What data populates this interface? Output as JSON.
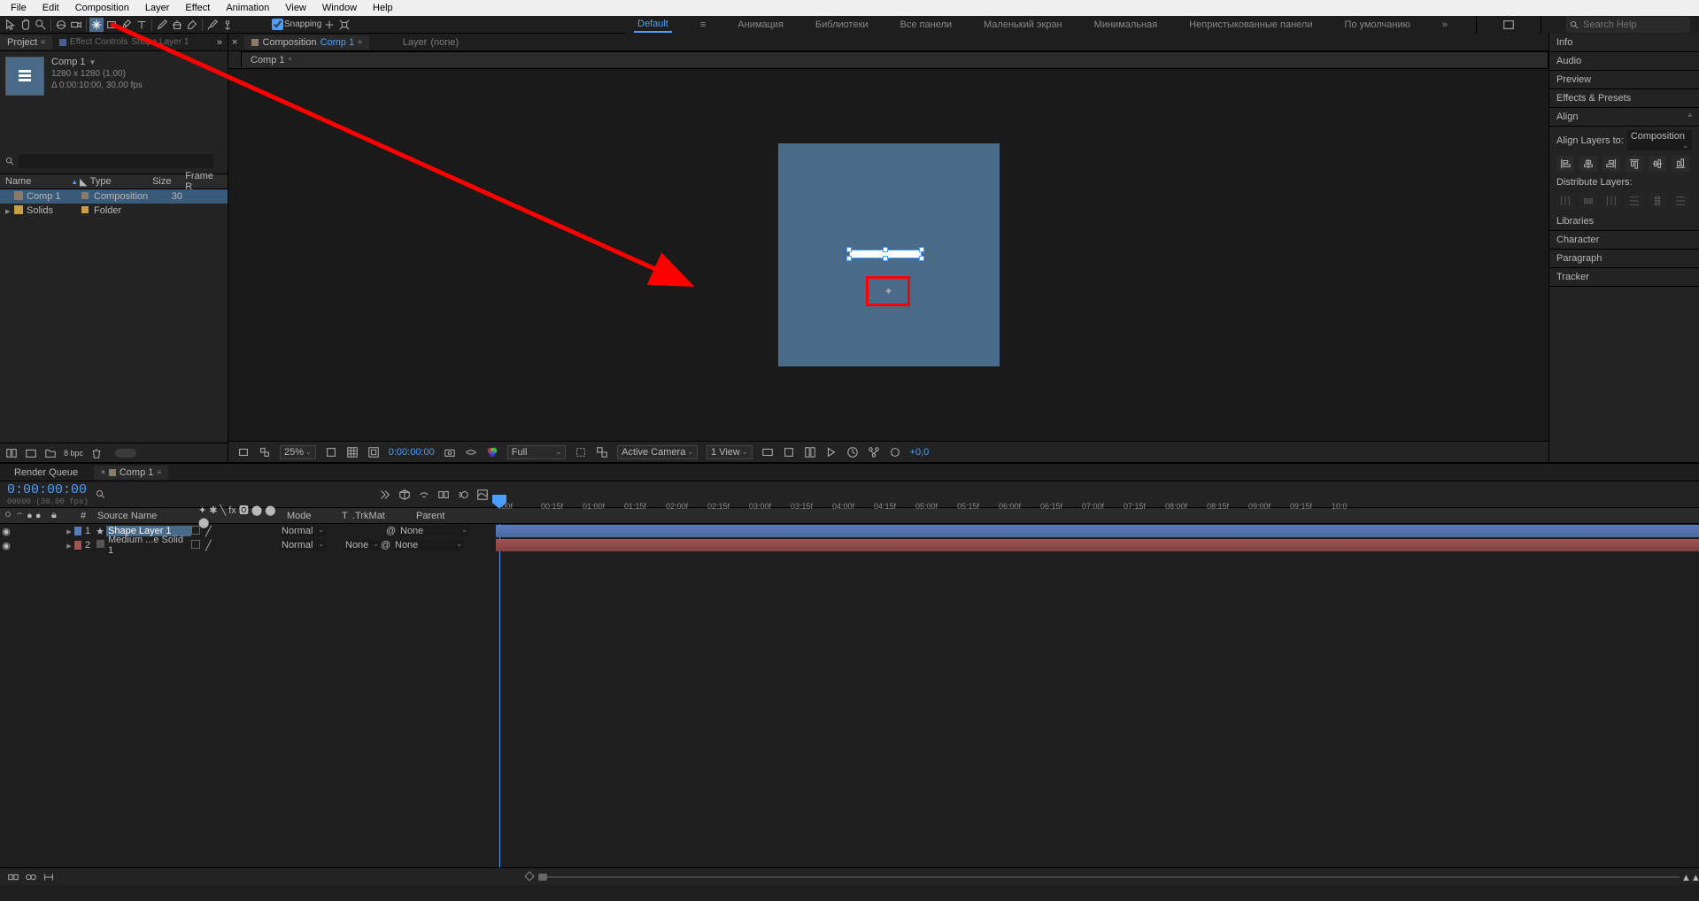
{
  "menu": {
    "file": "File",
    "edit": "Edit",
    "composition": "Composition",
    "layer": "Layer",
    "effect": "Effect",
    "animation": "Animation",
    "view": "View",
    "window": "Window",
    "help": "Help"
  },
  "toolbar": {
    "snapping": "Snapping"
  },
  "workspaces": {
    "default": "Default",
    "animation": "Анимация",
    "libraries": "Библиотеки",
    "all_panels": "Все панели",
    "small_screen": "Маленький экран",
    "minimal": "Минимальная",
    "undocked": "Непристыкованные панели",
    "default_ru": "По умолчанию",
    "search_ph": "Search Help"
  },
  "project": {
    "tab_project": "Project",
    "tab_effect_controls": "Effect Controls",
    "ec_layer": "Shape Layer 1",
    "comp_name": "Comp 1",
    "comp_dim": "1280 x 1280 (1,00)",
    "comp_dur": "Δ 0:00:10:00, 30,00 fps",
    "col_name": "Name",
    "col_type": "Type",
    "col_size": "Size",
    "col_frame": "Frame R",
    "rows": [
      {
        "name": "Comp 1",
        "type": "Composition",
        "size": "30"
      },
      {
        "name": "Solids",
        "type": "Folder",
        "size": ""
      }
    ],
    "bpc": "8 bpc"
  },
  "composition": {
    "tab": "Composition",
    "active": "Comp 1",
    "layer_tab": "Layer",
    "layer_none": "(none)",
    "inner_tab": "Comp 1"
  },
  "viewer_footer": {
    "zoom": "25%",
    "timecode": "0:00:00:00",
    "res": "Full",
    "camera": "Active Camera",
    "views": "1 View",
    "exposure": "+0,0"
  },
  "right": {
    "info": "Info",
    "audio": "Audio",
    "preview": "Preview",
    "effects": "Effects & Presets",
    "align": "Align",
    "align_to_lbl": "Align Layers to:",
    "align_to": "Composition",
    "distribute": "Distribute Layers:",
    "libraries": "Libraries",
    "character": "Character",
    "paragraph": "Paragraph",
    "tracker": "Tracker"
  },
  "timeline": {
    "render_queue": "Render Queue",
    "comp_tab": "Comp 1",
    "timecode": "0:00:00:00",
    "timecode_sub": "00000 (30.00 fps)",
    "col_num": "#",
    "col_src": "Source Name",
    "col_mode": "Mode",
    "col_t": "T",
    "col_trk": ".TrkMat",
    "col_parent": "Parent",
    "rows": [
      {
        "num": "1",
        "name": "Shape Layer 1",
        "mode": "Normal",
        "trk": "",
        "parent": "None",
        "color": "#5a7ac0",
        "selected": true
      },
      {
        "num": "2",
        "name": "Medium ...e Solid 1",
        "mode": "Normal",
        "trk": "None",
        "parent": "None",
        "color": "#a05555",
        "selected": false
      }
    ],
    "ticks": [
      ":00f",
      "00:15f",
      "01:00f",
      "01:15f",
      "02:00f",
      "02:15f",
      "03:00f",
      "03:15f",
      "04:00f",
      "04:15f",
      "05:00f",
      "05:15f",
      "06:00f",
      "06:15f",
      "07:00f",
      "07:15f",
      "08:00f",
      "08:15f",
      "09:00f",
      "09:15f",
      "10:0"
    ]
  }
}
